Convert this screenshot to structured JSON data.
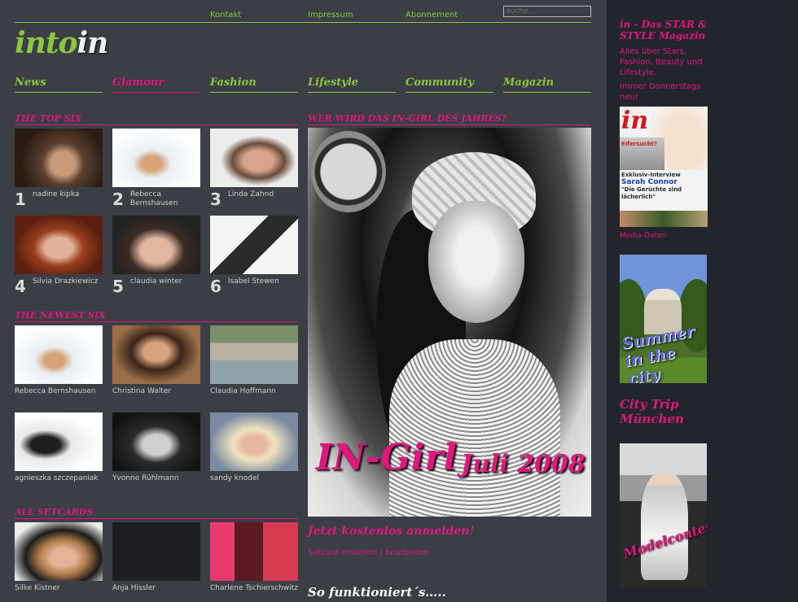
{
  "header": {
    "links": [
      "Kontakt",
      "Impressum",
      "Abonnement"
    ],
    "search_placeholder": "suche...",
    "logo_part1": "into",
    "logo_part2": "in"
  },
  "nav": [
    {
      "label": "News",
      "color": "#8cc63f"
    },
    {
      "label": "Glamour",
      "color": "#e0177d"
    },
    {
      "label": "Fashion",
      "color": "#8cc63f"
    },
    {
      "label": "Lifestyle",
      "color": "#8cc63f"
    },
    {
      "label": "Community",
      "color": "#8cc63f"
    },
    {
      "label": "Magazin",
      "color": "#8cc63f"
    }
  ],
  "sections": {
    "top_six": "THE TOP SIX",
    "newest_six": "THE NEWEST SIX",
    "all_setcards": "ALL SETCARDS",
    "featured": "WER WIRD DAS IN-GIRL DES JAHRES?"
  },
  "top_six": [
    {
      "rank": "1",
      "name": "nadine kipka"
    },
    {
      "rank": "2",
      "name": "Rebecca Bernshausen"
    },
    {
      "rank": "3",
      "name": "Linda Zahnd"
    },
    {
      "rank": "4",
      "name": "Silvia Drazkiewicz"
    },
    {
      "rank": "5",
      "name": "claudia winter"
    },
    {
      "rank": "6",
      "name": "Isabel Stewen"
    }
  ],
  "newest_six": [
    {
      "name": "Rebecca Bernshausen"
    },
    {
      "name": "Christina Walter"
    },
    {
      "name": "Claudia Hoffmann"
    },
    {
      "name": "agnieszka szczepaniak"
    },
    {
      "name": "Yvonne Rühlmann"
    },
    {
      "name": "sandy knodel"
    }
  ],
  "setcards": [
    {
      "name": "Silke Kistner"
    },
    {
      "name": "Anja Hissler"
    },
    {
      "name": "Charlene Tschierschwitz"
    }
  ],
  "featured": {
    "overlay_title": "IN-Girl",
    "overlay_date": "Juli 2008",
    "cta": "Jetzt kostenlos anmelden!",
    "cta_link": "Setcard erstellen / bearbeiten",
    "how": "So funktioniert´s….."
  },
  "sidebar": {
    "mag_title": "in - Das STAR & STYLE Magazin",
    "mag_desc": "Alles über Stars, Fashion, Beauty und Lifestyle.",
    "mag_day": "Immer Donnerstags neu!",
    "cover_logo": "in",
    "cover_text1": "Eifersucht?",
    "cover_text2": "Exklusiv-Interview",
    "cover_text3": "Sarah Connor",
    "cover_text4": "\"Die Gerüchte sind lächerlich\"",
    "media_link": "Media-Daten",
    "summer_text": "Summer in the city",
    "city_trip": "City Trip München",
    "model_text": "Modelcontest"
  },
  "colors": {
    "accent_green": "#8cc63f",
    "accent_pink": "#e0177d",
    "background": "#3b3e44",
    "sidebar": "#22252b"
  }
}
